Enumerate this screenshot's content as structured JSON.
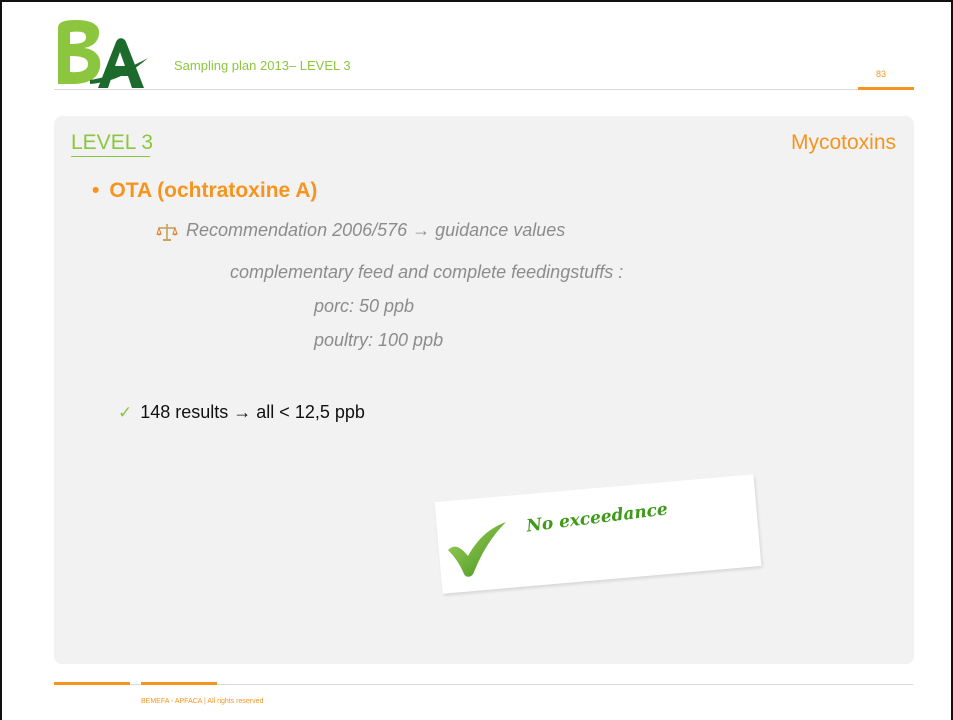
{
  "header": {
    "title": "Sampling plan 2013– LEVEL 3",
    "page_number": "83",
    "logo_icon": "ba-logo"
  },
  "slide": {
    "level_title": "LEVEL 3",
    "topic_title": "Mycotoxins",
    "bullet": "OTA (ochtratoxine A)",
    "recommendation": "Recommendation 2006/576 → guidance values",
    "feed_line": "complementary feed and complete feedingstuffs :",
    "porc": "porc: 50 ppb",
    "poultry": "poultry: 100 ppb",
    "results": "148 results → all < 12,5 ppb",
    "sticker": "No exceedance"
  },
  "footer": {
    "text": "BEMEFA - APFACA  |  All rights reserved"
  },
  "colors": {
    "green": "#8cc63f",
    "orange": "#f7941d",
    "grey_text": "#8c8c8c",
    "panel": "#f2f2f2"
  }
}
